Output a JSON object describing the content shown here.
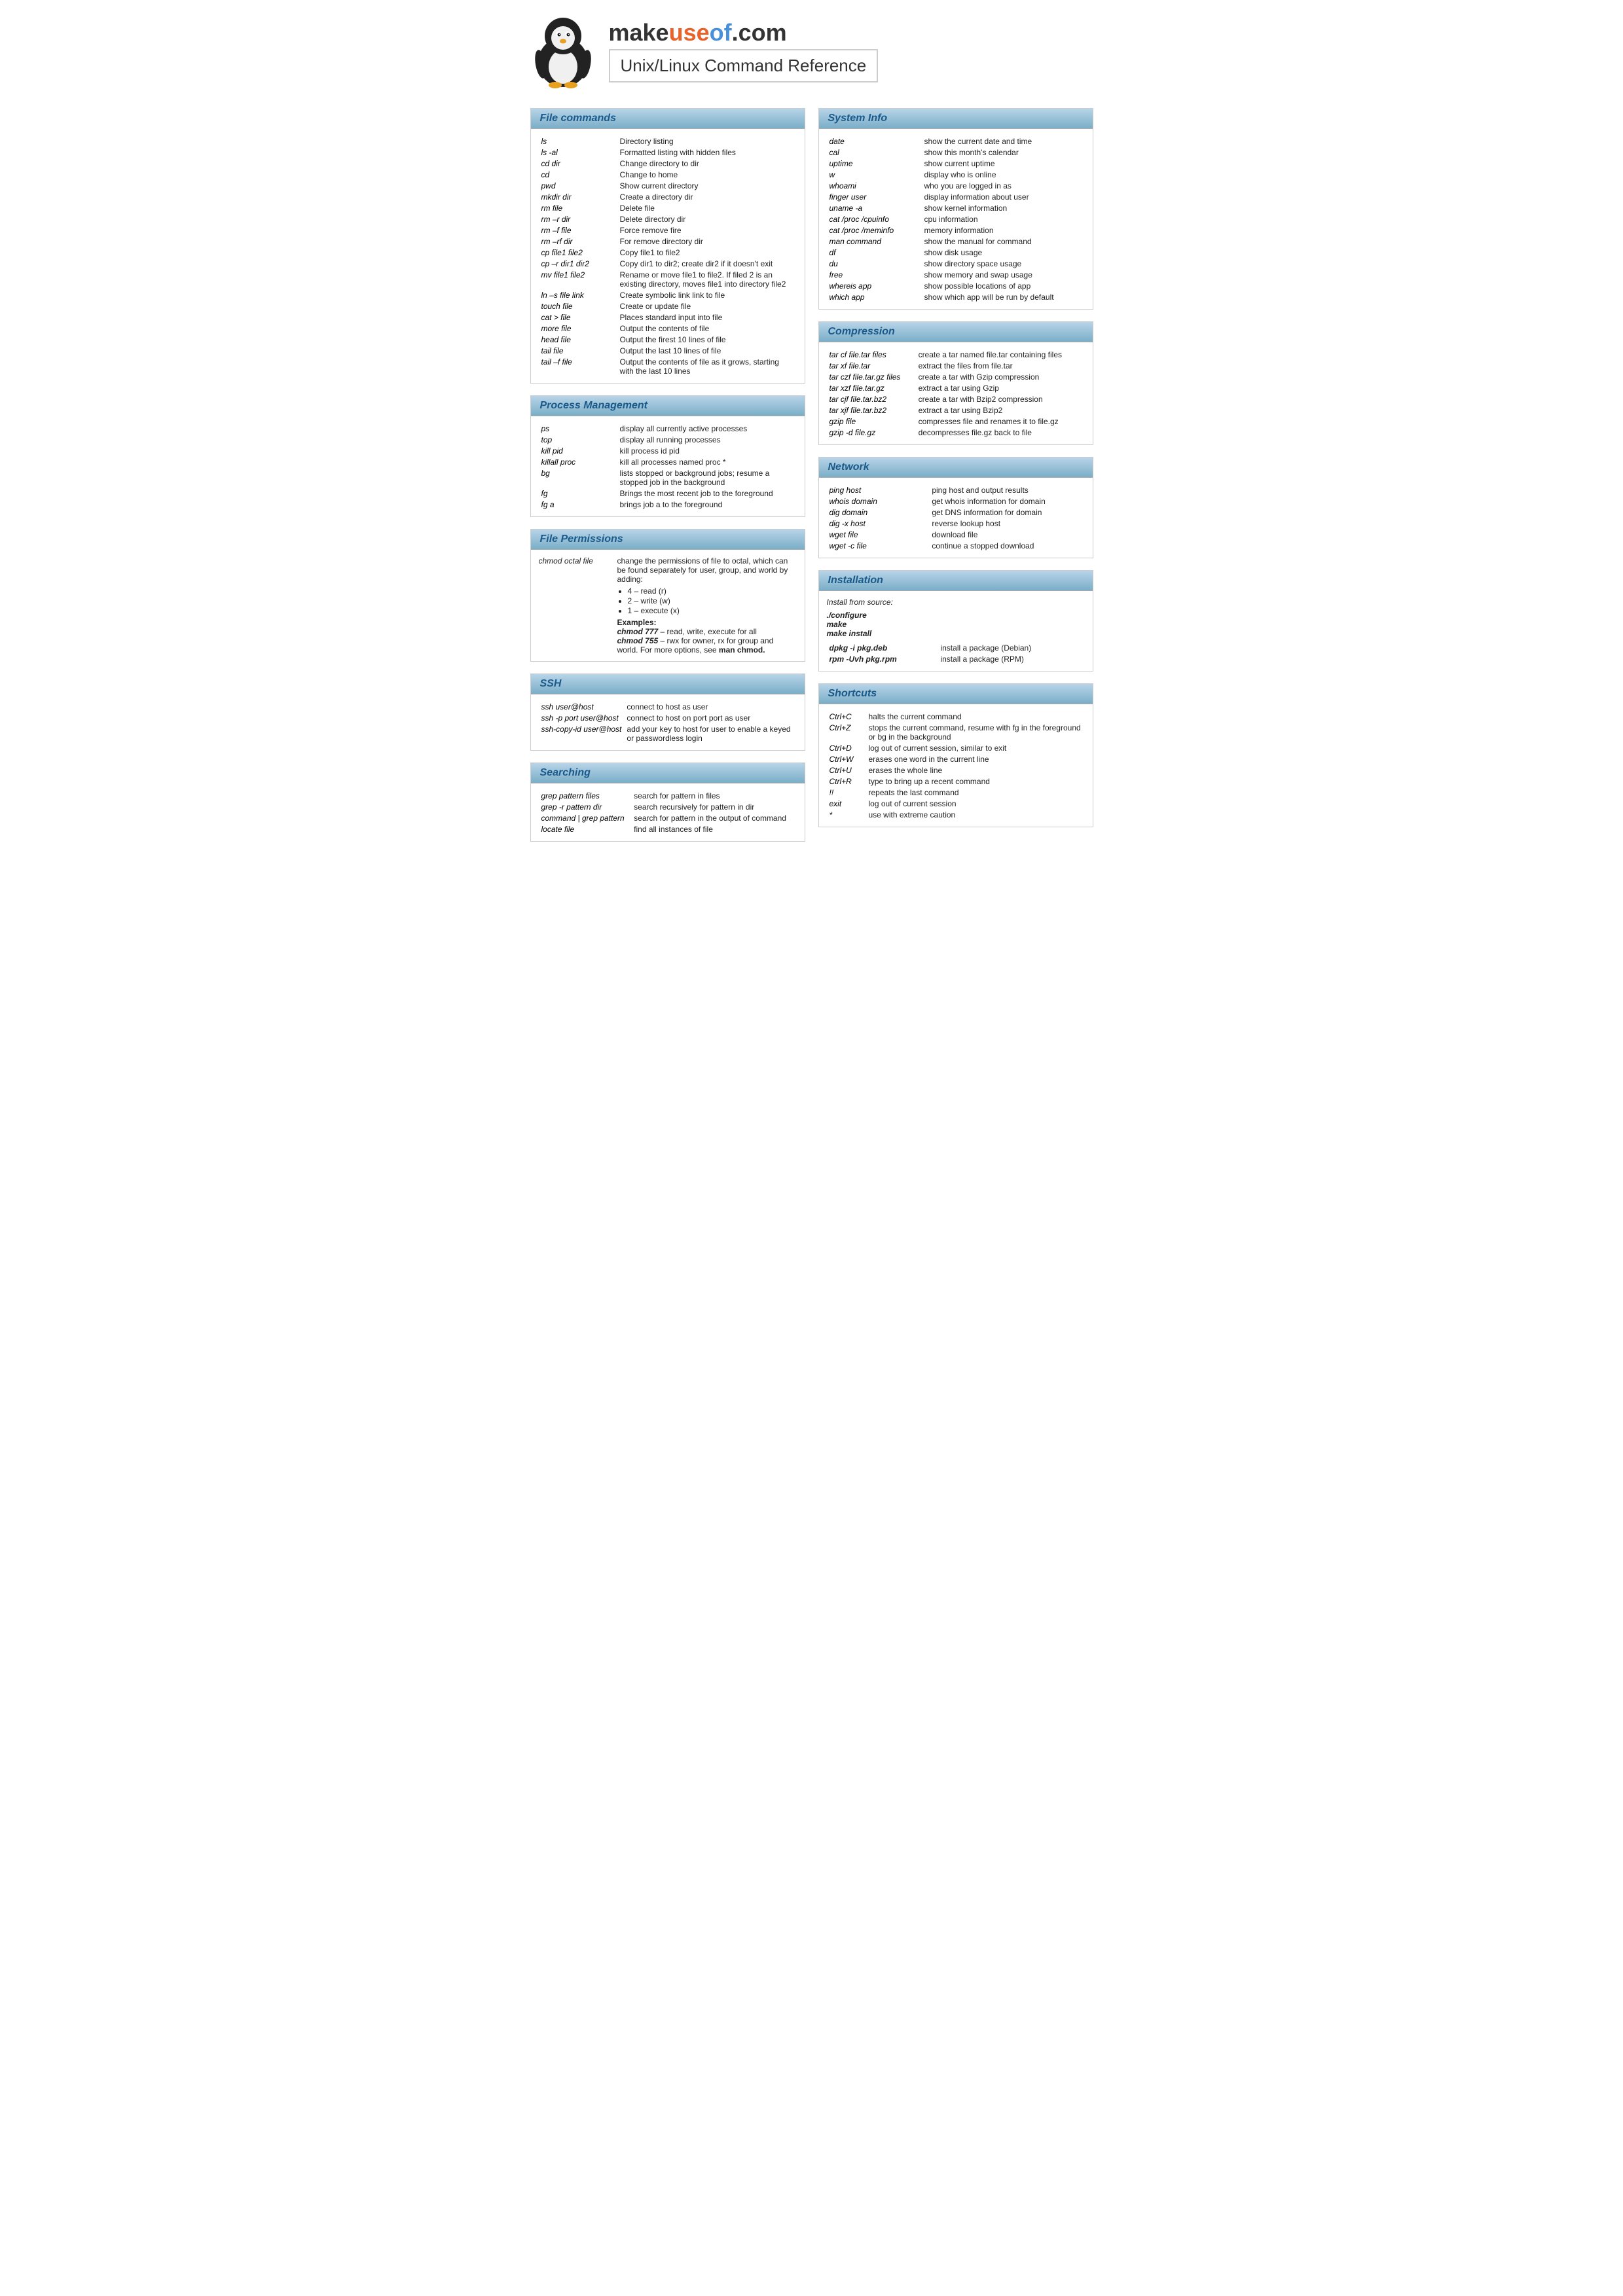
{
  "header": {
    "site_name_make": "make",
    "site_name_use": "use",
    "site_name_of": "of",
    "site_name_com": ".com",
    "page_title": "Unix/Linux Command Reference"
  },
  "sections": {
    "file_commands": {
      "title": "File commands",
      "commands": [
        [
          "ls",
          "Directory listing"
        ],
        [
          "ls -al",
          "Formatted listing with hidden files"
        ],
        [
          "cd dir",
          "Change directory to dir"
        ],
        [
          "cd",
          "Change to home"
        ],
        [
          "pwd",
          "Show current directory"
        ],
        [
          "mkdir dir",
          "Create a directory dir"
        ],
        [
          "rm file",
          "Delete file"
        ],
        [
          "rm –r dir",
          "Delete directory dir"
        ],
        [
          "rm –f file",
          "Force remove fire"
        ],
        [
          "rm –rf dir",
          "For remove directory dir"
        ],
        [
          "cp file1 file2",
          "Copy file1 to file2"
        ],
        [
          "cp –r dir1 dir2",
          "Copy dir1 to dir2; create dir2 if it doesn't exit"
        ],
        [
          "mv file1 file2",
          "Rename or move file1 to file2. If filed 2 is an existing directory, moves file1 into directory  file2"
        ],
        [
          "ln –s file link",
          "Create symbolic link link to file"
        ],
        [
          "touch file",
          "Create or update file"
        ],
        [
          "cat > file",
          "Places standard input into file"
        ],
        [
          "more file",
          "Output the contents of file"
        ],
        [
          "head file",
          "Output the firest 10 lines of file"
        ],
        [
          "tail file",
          "Output the last 10 lines of file"
        ],
        [
          "tail –f file",
          "Output the contents of file as it grows, starting with the last 10 lines"
        ]
      ]
    },
    "process_management": {
      "title": "Process Management",
      "commands": [
        [
          "ps",
          "display all currently active processes"
        ],
        [
          "top",
          "display all running processes"
        ],
        [
          "kill pid",
          "kill process id pid"
        ],
        [
          "killall proc",
          "kill all processes named proc *"
        ],
        [
          "bg",
          "lists stopped or background jobs; resume a stopped job in the background"
        ],
        [
          "fg",
          "Brings the most recent job to the foreground"
        ],
        [
          "fg a",
          "brings job a to the foreground"
        ]
      ]
    },
    "file_permissions": {
      "title": "File Permissions",
      "chmod_cmd": "chmod octal file",
      "chmod_desc": "change the permissions of file to octal, which can be found separately for user, group, and world by adding:",
      "values": [
        "4 – read (r)",
        "2 – write (w)",
        "1 – execute (x)"
      ],
      "examples_label": "Examples:",
      "example1": "chmod 777",
      "example1_desc": "– read, write, execute for all",
      "example2": "chmod 755",
      "example2_desc": "– rwx for owner, rx for group and world. For more options, see",
      "man_chmod": "man chmod."
    },
    "ssh": {
      "title": "SSH",
      "commands": [
        [
          "ssh user@host",
          "connect to host as user"
        ],
        [
          "ssh -p port user@host",
          "connect to host on port port as user"
        ],
        [
          "ssh-copy-id user@host",
          "add your key to host for user to enable a keyed or passwordless login"
        ]
      ]
    },
    "searching": {
      "title": "Searching",
      "commands": [
        [
          "grep pattern files",
          "search for pattern in files"
        ],
        [
          "grep -r pattern dir",
          "search recursively for pattern in dir"
        ],
        [
          "command | grep pattern",
          "search for pattern in the output of command"
        ],
        [
          "locate file",
          "find all instances of file"
        ]
      ]
    },
    "system_info": {
      "title": "System Info",
      "commands": [
        [
          "date",
          "show the current date and time"
        ],
        [
          "cal",
          "show this month's calendar"
        ],
        [
          "uptime",
          "show current uptime"
        ],
        [
          "w",
          "display who is online"
        ],
        [
          "whoami",
          "who you are logged in as"
        ],
        [
          "finger user",
          "display information about user"
        ],
        [
          "uname -a",
          "show kernel information"
        ],
        [
          "cat /proc /cpuinfo",
          "cpu information"
        ],
        [
          "cat /proc /meminfo",
          "memory information"
        ],
        [
          "man command",
          "show the manual for command"
        ],
        [
          "df",
          "show disk usage"
        ],
        [
          "du",
          "show directory space usage"
        ],
        [
          "free",
          "show memory and swap usage"
        ],
        [
          "whereis app",
          "show possible locations of app"
        ],
        [
          "which app",
          "show which app will be run by default"
        ]
      ]
    },
    "compression": {
      "title": "Compression",
      "commands": [
        [
          "tar cf file.tar files",
          "create a tar named file.tar containing files"
        ],
        [
          "tar xf file.tar",
          "extract the files from file.tar"
        ],
        [
          "tar czf file.tar.gz files",
          "create a tar with Gzip compression"
        ],
        [
          "tar xzf file.tar.gz",
          "extract a tar using Gzip"
        ],
        [
          "tar cjf file.tar.bz2",
          "create a tar with Bzip2 compression"
        ],
        [
          "tar xjf file.tar.bz2",
          "extract a tar using Bzip2"
        ],
        [
          "gzip file",
          "compresses file and renames it to file.gz"
        ],
        [
          "gzip -d file.gz",
          "decompresses file.gz back to file"
        ]
      ]
    },
    "network": {
      "title": "Network",
      "commands": [
        [
          "ping host",
          "ping host and output results"
        ],
        [
          "whois domain",
          "get whois information for domain"
        ],
        [
          "dig domain",
          "get DNS information for domain"
        ],
        [
          "dig -x host",
          "reverse lookup host"
        ],
        [
          "wget file",
          "download file"
        ],
        [
          "wget -c file",
          "continue a stopped download"
        ]
      ]
    },
    "installation": {
      "title": "Installation",
      "source_label": "Install from source:",
      "source_commands": [
        "./configure",
        "make",
        "make install"
      ],
      "package_commands": [
        [
          "dpkg -i pkg.deb",
          "install a package (Debian)"
        ],
        [
          "rpm -Uvh pkg.rpm",
          "install a package (RPM)"
        ]
      ]
    },
    "shortcuts": {
      "title": "Shortcuts",
      "commands": [
        [
          "Ctrl+C",
          "halts the current command"
        ],
        [
          "Ctrl+Z",
          "stops the current command, resume with fg in the foreground or bg in the background"
        ],
        [
          "Ctrl+D",
          "log out of current session, similar to exit"
        ],
        [
          "Ctrl+W",
          "erases one word in the current line"
        ],
        [
          "Ctrl+U",
          "erases the whole line"
        ],
        [
          "Ctrl+R",
          "type to bring up a recent command"
        ],
        [
          "!!",
          "repeats the last command"
        ],
        [
          "exit",
          "log out of current session"
        ],
        [
          "*",
          "use with extreme caution"
        ]
      ]
    }
  }
}
